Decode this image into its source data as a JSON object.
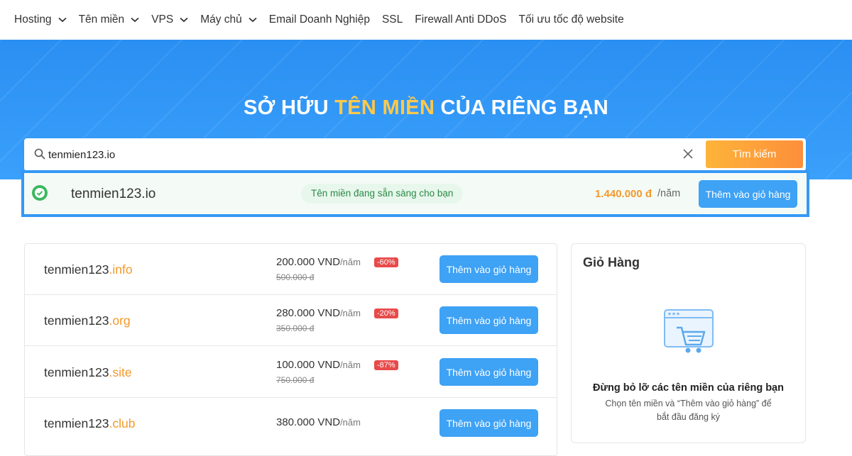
{
  "nav": {
    "items": [
      {
        "label": "Hosting",
        "dropdown": true
      },
      {
        "label": "Tên miền",
        "dropdown": true
      },
      {
        "label": "VPS",
        "dropdown": true
      },
      {
        "label": "Máy chủ",
        "dropdown": true
      },
      {
        "label": "Email Doanh Nghiệp",
        "dropdown": false
      },
      {
        "label": "SSL",
        "dropdown": false
      },
      {
        "label": "Firewall Anti DDoS",
        "dropdown": false
      },
      {
        "label": "Tối ưu tốc độ website",
        "dropdown": false
      }
    ]
  },
  "hero": {
    "title_before": "SỞ HỮU ",
    "title_highlight": "TÊN MIỀN",
    "title_after": " CỦA RIÊNG BẠN"
  },
  "search": {
    "value": "tenmien123.io",
    "button_label": "Tìm kiếm"
  },
  "result": {
    "domain": "tenmien123.io",
    "status": "Tên miền đang sẵn sàng cho bạn",
    "price": "1.440.000 đ",
    "unit": "/năm",
    "button_label": "Thêm vào giỏ hàng"
  },
  "domains": [
    {
      "name": "tenmien123",
      "ext": ".info",
      "price": "200.000 VND",
      "per": "/năm",
      "old_price": "500.000 đ",
      "discount": "-60%",
      "button_label": "Thêm vào giỏ hàng"
    },
    {
      "name": "tenmien123",
      "ext": ".org",
      "price": "280.000 VND",
      "per": "/năm",
      "old_price": "350.000 đ",
      "discount": "-20%",
      "button_label": "Thêm vào giỏ hàng"
    },
    {
      "name": "tenmien123",
      "ext": ".site",
      "price": "100.000 VND",
      "per": "/năm",
      "old_price": "750.000 đ",
      "discount": "-87%",
      "button_label": "Thêm vào giỏ hàng"
    },
    {
      "name": "tenmien123",
      "ext": ".club",
      "price": "380.000 VND",
      "per": "/năm",
      "old_price": "",
      "discount": "",
      "button_label": "Thêm vào giỏ hàng"
    }
  ],
  "cart": {
    "title": "Giỏ Hàng",
    "empty_title": "Đừng bỏ lỡ các tên miền của riêng bạn",
    "empty_desc": "Chọn tên miền và “Thêm vào giỏ hàng” để bắt đầu đăng ký"
  },
  "colors": {
    "hero_blue": "#2a8ff2",
    "highlight_yellow": "#ffc94a",
    "accent_orange": "#f39a2b",
    "button_blue": "#3ea2f5",
    "discount_red": "#e84a4a"
  }
}
